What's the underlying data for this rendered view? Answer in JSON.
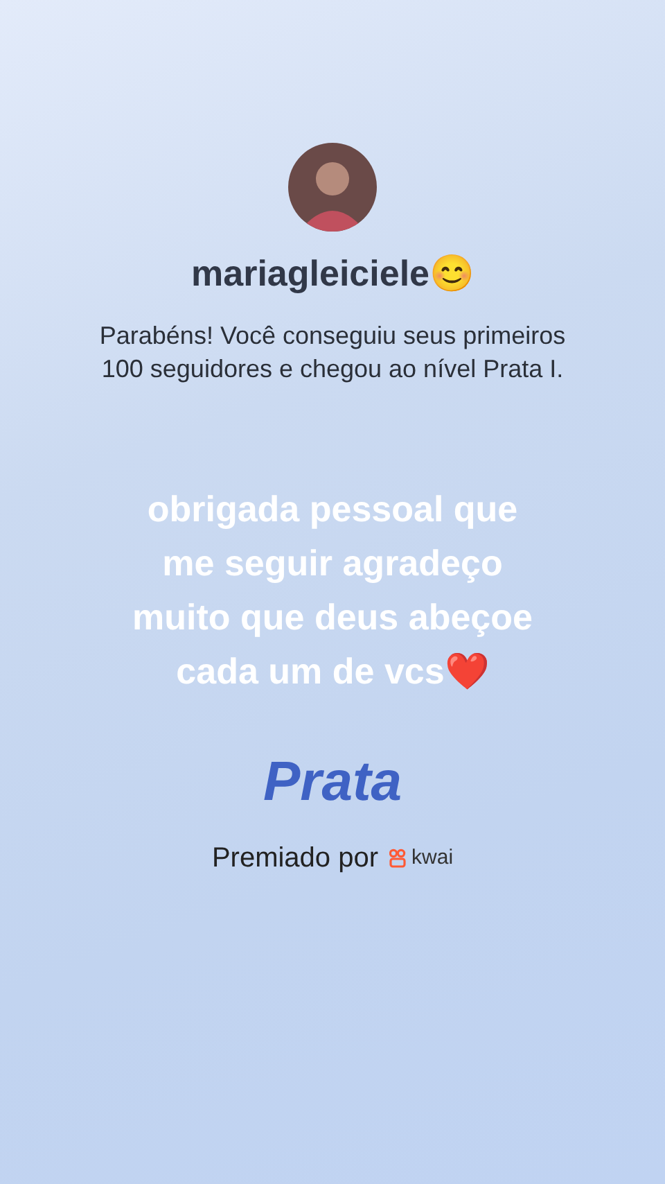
{
  "profile": {
    "username": "mariagleiciele😊"
  },
  "achievement": {
    "description": "Parabéns! Você conseguiu seus primeiros 100 seguidores e chegou ao nível Prata I."
  },
  "message": "obrigada pessoal que me seguir agradeço muito que deus abeçoe cada um de vcs❤️",
  "level": {
    "name": "Prata"
  },
  "footer": {
    "label": "Premiado por",
    "brand": "kwai"
  }
}
